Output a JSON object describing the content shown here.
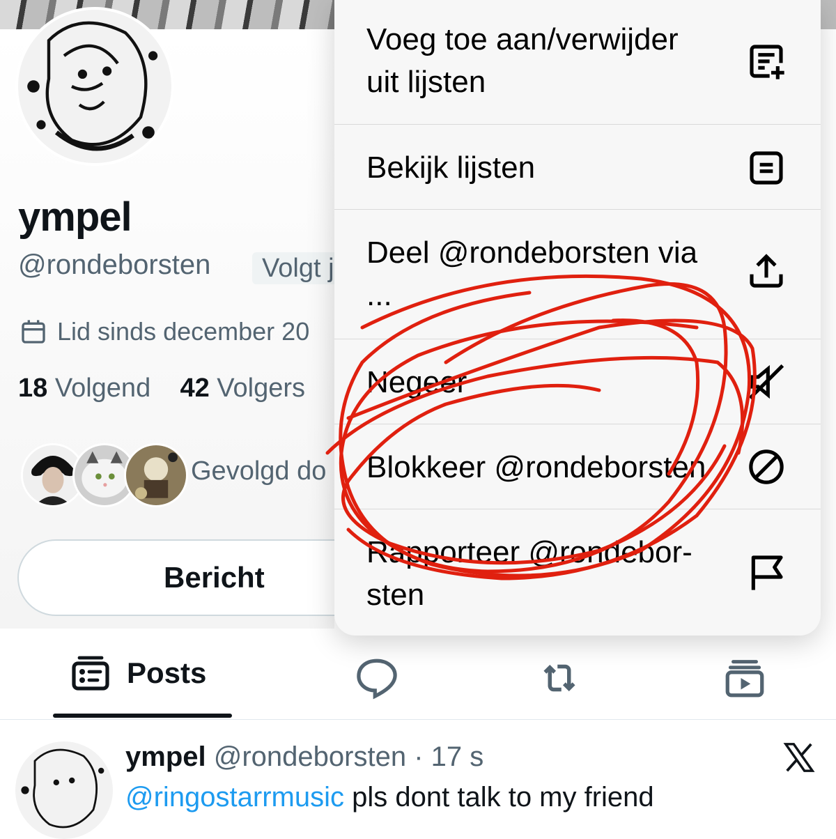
{
  "profile": {
    "display_name": "ympel",
    "handle": "@rondeborsten",
    "follows_you_badge": "Volgt j",
    "joined": "Lid sinds december 20",
    "following_count": "18",
    "following_label": "Volgend",
    "followers_count": "42",
    "followers_label": "Volgers",
    "followed_by": "Gevolgd do",
    "message_button": "Bericht"
  },
  "tabs": {
    "posts_label": "Posts"
  },
  "tweet": {
    "author_name": "ympel",
    "author_handle": "@rondeborsten",
    "separator": "·",
    "time": "17 s",
    "mention": "@ringostarrmusic",
    "text": " pls dont talk to my friend"
  },
  "menu": {
    "items": [
      {
        "label_line1": "Voeg toe aan/verwijder",
        "label_line2": "uit lijsten",
        "icon": "list-add-icon"
      },
      {
        "label_line1": "Bekijk lijsten",
        "icon": "list-icon"
      },
      {
        "label_line1": "Deel @rondeborsten via",
        "label_line2": "...",
        "icon": "share-icon"
      },
      {
        "label_line1": "Negeer",
        "icon": "mute-icon"
      },
      {
        "label_line1": "Blokkeer @rondeborsten",
        "icon": "block-icon"
      },
      {
        "label_line1": "Rapporteer @rondebor-",
        "label_line2": "sten",
        "icon": "flag-icon"
      }
    ]
  },
  "colors": {
    "annotation_red": "#e0200f",
    "secondary_text": "#536471",
    "link_blue": "#1d9bf0"
  }
}
